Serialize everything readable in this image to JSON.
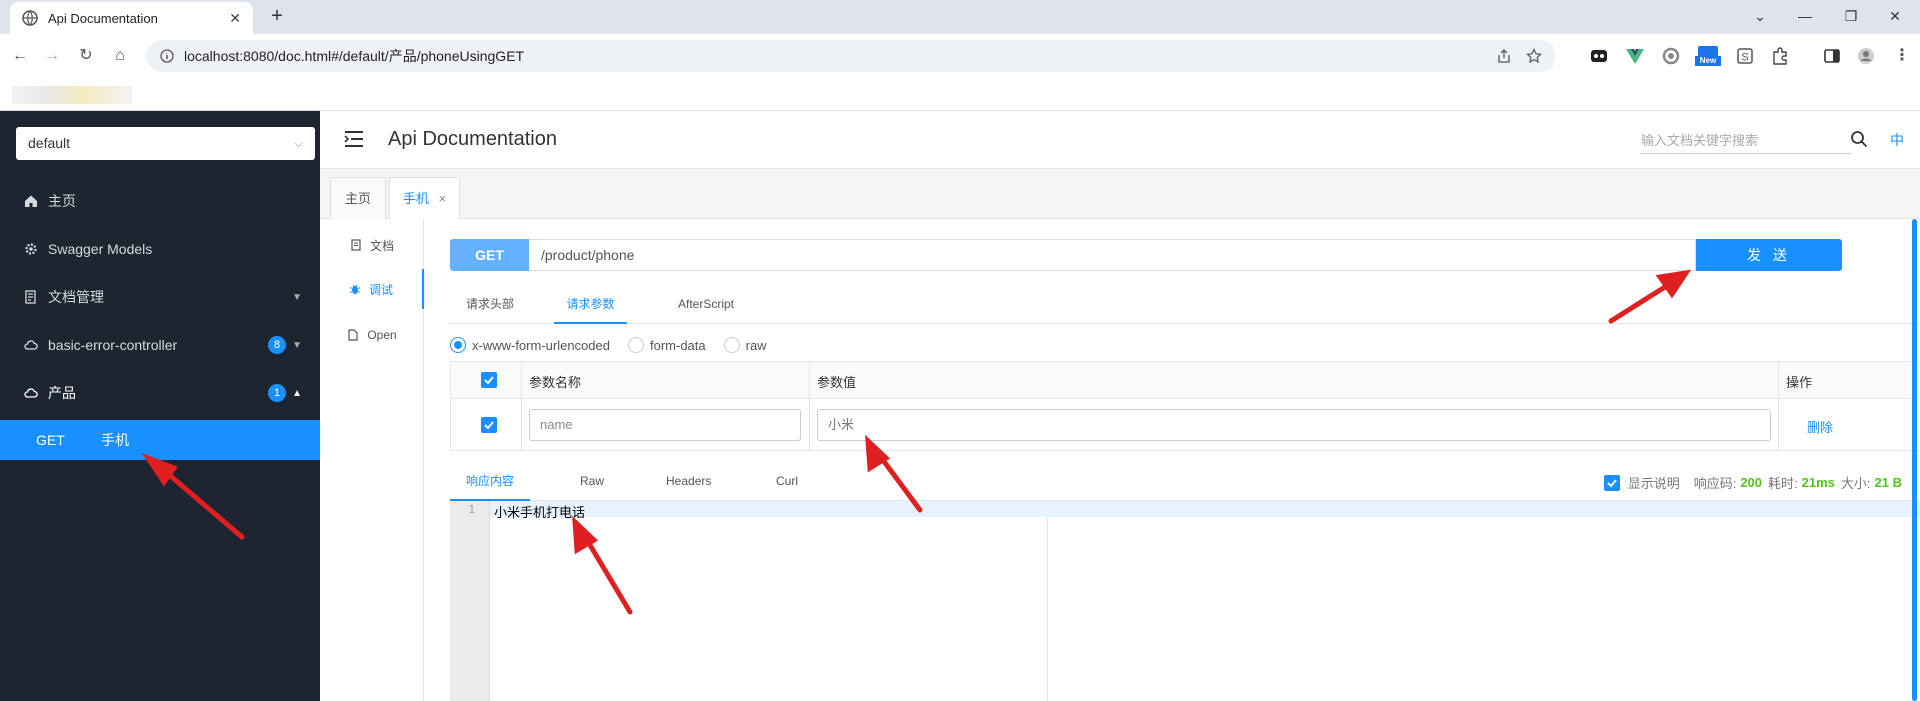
{
  "browser": {
    "tab_title": "Api Documentation",
    "tab_close": "✕",
    "new_tab": "+",
    "url": "localhost:8080/doc.html#/default/产品/phoneUsingGET",
    "window_buttons": [
      "⌄",
      "—",
      "❐",
      "✕"
    ],
    "extensions_new_badge": "New"
  },
  "sidebar": {
    "group_select": "default",
    "items": [
      {
        "label": "主页",
        "icon": "home-icon"
      },
      {
        "label": "Swagger Models",
        "icon": "gear-icon"
      },
      {
        "label": "文档管理",
        "icon": "docs-icon"
      },
      {
        "label": "basic-error-controller",
        "icon": "cloud-icon",
        "badge": "8"
      },
      {
        "label": "产品",
        "icon": "cloud-icon",
        "badge": "1"
      }
    ],
    "sub_item": {
      "method": "GET",
      "label": "手机"
    }
  },
  "header": {
    "title": "Api Documentation",
    "search_placeholder": "输入文档关键字搜索",
    "lang": "中"
  },
  "page_tabs": [
    {
      "label": "主页"
    },
    {
      "label": "手机",
      "close": "×"
    }
  ],
  "left_nav": [
    {
      "label": "文档"
    },
    {
      "label": "调试"
    },
    {
      "label": "Open"
    }
  ],
  "request": {
    "method": "GET",
    "path": "/product/phone",
    "send_label": "发 送",
    "tabs": [
      "请求头部",
      "请求参数",
      "AfterScript"
    ],
    "content_types": [
      "x-www-form-urlencoded",
      "form-data",
      "raw"
    ],
    "table": {
      "headers": [
        "参数名称",
        "参数值",
        "操作"
      ],
      "rows": [
        {
          "name": "name",
          "value": "小米",
          "action": "删除"
        }
      ]
    }
  },
  "response": {
    "tabs": [
      "响应内容",
      "Raw",
      "Headers",
      "Curl"
    ],
    "show_desc": "显示说明",
    "code_label": "响应码:",
    "code": "200",
    "time_label": "耗时:",
    "time": "21ms",
    "size_label": "大小:",
    "size": "21 B",
    "line_no": "1",
    "body": "小米手机打电话"
  },
  "colors": {
    "accent": "#1890ff",
    "sidebar_bg": "#1f2530",
    "arrow": "#e02020",
    "success": "#52c41a"
  }
}
